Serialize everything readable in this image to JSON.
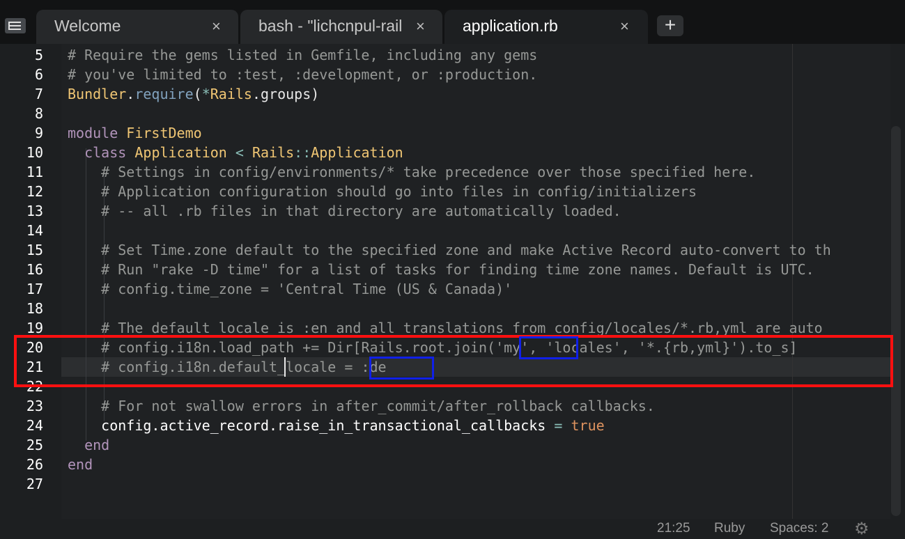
{
  "tabs": [
    {
      "label": "Welcome",
      "close": "×",
      "active": false
    },
    {
      "label": "bash - \"lichcnpul-rail",
      "close": "×",
      "active": false
    },
    {
      "label": "application.rb",
      "close": "×",
      "active": true
    }
  ],
  "new_tab_label": "+",
  "status": {
    "position": "21:25",
    "language": "Ruby",
    "indent": "Spaces: 2"
  },
  "line_numbers": [
    "5",
    "6",
    "7",
    "8",
    "9",
    "10",
    "11",
    "12",
    "13",
    "14",
    "15",
    "16",
    "17",
    "18",
    "19",
    "20",
    "21",
    "22",
    "23",
    "24",
    "25",
    "26",
    "27"
  ],
  "code": {
    "l5": "# Require the gems listed in Gemfile, including any gems",
    "l6": "# you've limited to :test, :development, or :production.",
    "l7_a": "Bundler",
    "l7_b": ".",
    "l7_c": "require",
    "l7_d": "(",
    "l7_e": "*",
    "l7_f": "Rails",
    "l7_g": ".groups)",
    "l9_a": "module",
    "l9_b": "FirstDemo",
    "l10_a": "class",
    "l10_b": "Application",
    "l10_c": "<",
    "l10_d": "Rails",
    "l10_e": "::",
    "l10_f": "Application",
    "l11": "# Settings in config/environments/* take precedence over those specified here.",
    "l12": "# Application configuration should go into files in config/initializers",
    "l13": "# -- all .rb files in that directory are automatically loaded.",
    "l15": "# Set Time.zone default to the specified zone and make Active Record auto-convert to th",
    "l16": "# Run \"rake -D time\" for a list of tasks for finding time zone names. Default is UTC.",
    "l17": "# config.time_zone = 'Central Time (US & Canada)'",
    "l19": "# The default locale is :en and all translations from config/locales/*.rb,yml are auto",
    "l20": "# config.i18n.load_path += Dir[Rails.root.join('my', 'locales', '*.{rb,yml}').to_s]",
    "l21": "# config.i18n.default_locale = :de",
    "l23": "# For not swallow errors in after_commit/after_rollback callbacks.",
    "l24_a": "config.active_record.raise_in_transactional_callbacks",
    "l24_b": "=",
    "l24_c": "true",
    "l25": "end",
    "l26": "end"
  }
}
